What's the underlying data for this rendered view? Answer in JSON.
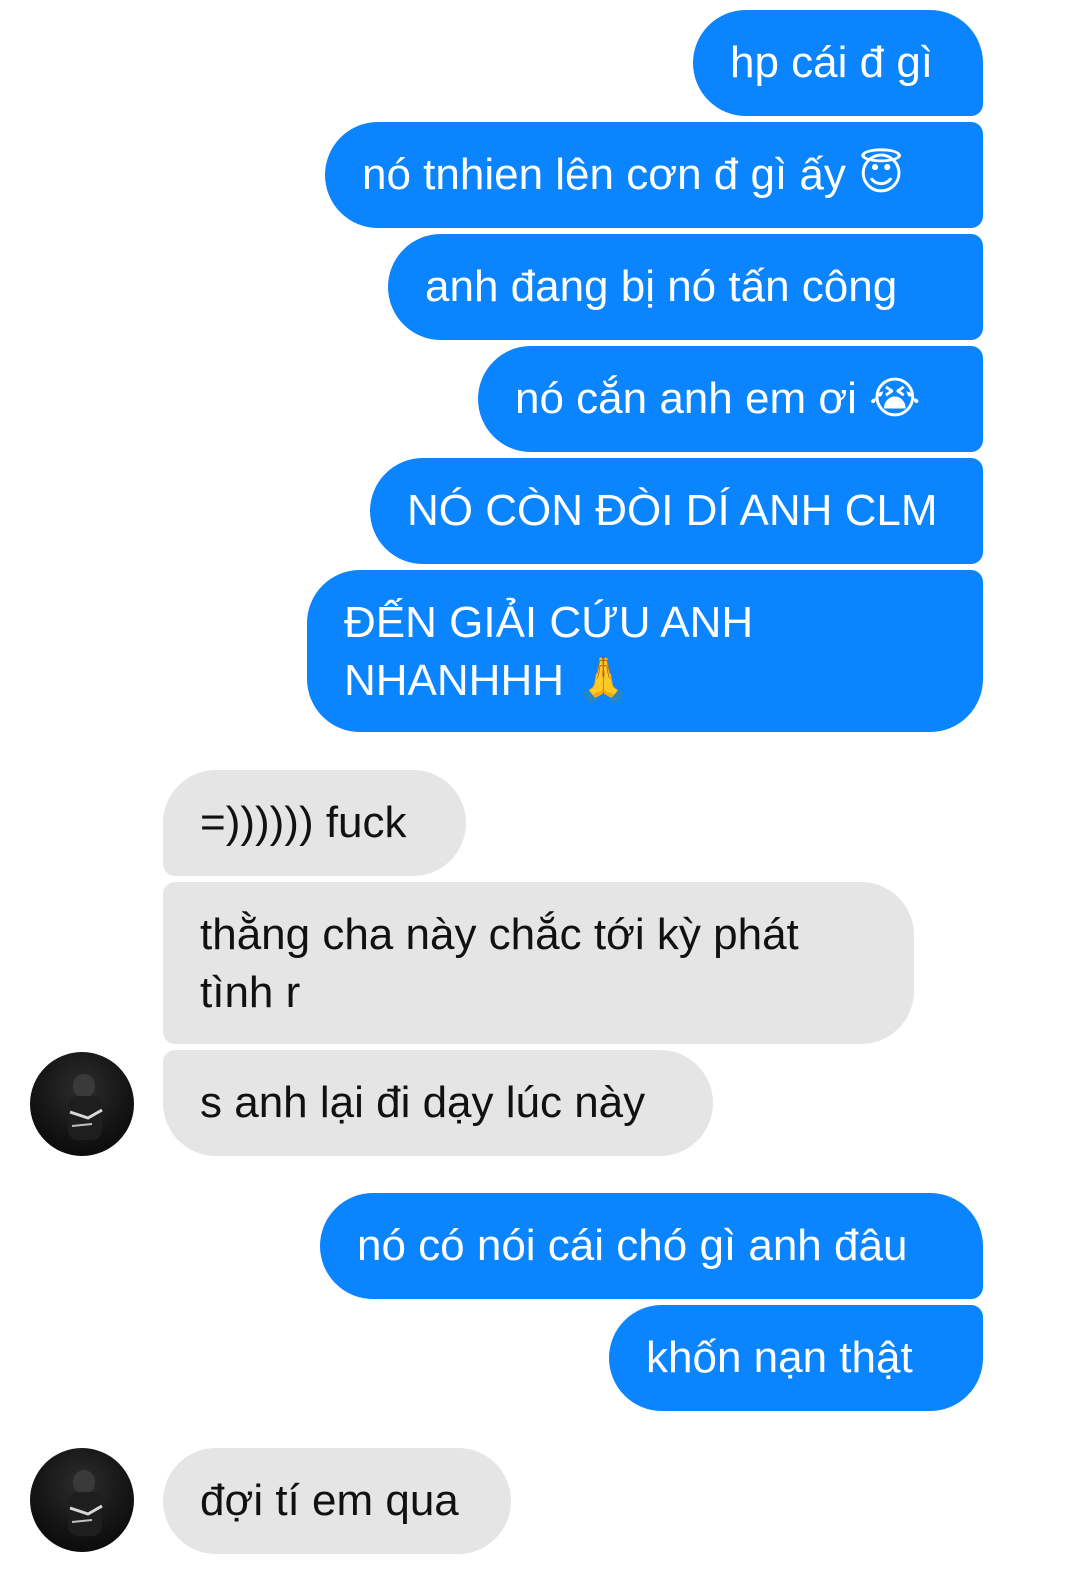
{
  "conversation": {
    "messages": [
      {
        "id": "m1",
        "side": "outgoing",
        "text": "hp cái đ gì"
      },
      {
        "id": "m2",
        "side": "outgoing",
        "text": "nó tnhien lên cơn đ gì ấy 😇"
      },
      {
        "id": "m3",
        "side": "outgoing",
        "text": "anh đang bị nó tấn công"
      },
      {
        "id": "m4",
        "side": "outgoing",
        "text": "nó cắn anh em ơi 😭"
      },
      {
        "id": "m5",
        "side": "outgoing",
        "text": "NÓ CÒN ĐÒI DÍ ANH CLM"
      },
      {
        "id": "m6",
        "side": "outgoing",
        "text": "ĐẾN GIẢI CỨU ANH\nNHANHHH 🙏"
      },
      {
        "id": "m7",
        "side": "incoming",
        "text": "=)))))) fuck"
      },
      {
        "id": "m8",
        "side": "incoming",
        "text": "thằng cha này chắc tới kỳ phát\ntình r"
      },
      {
        "id": "m9",
        "side": "incoming",
        "text": "s anh lại đi dạy lúc này"
      },
      {
        "id": "m10",
        "side": "outgoing",
        "text": "nó có nói cái chó gì anh đâu"
      },
      {
        "id": "m11",
        "side": "outgoing",
        "text": "khốn nạn thật"
      },
      {
        "id": "m12",
        "side": "incoming",
        "text": "đợi tí em qua"
      }
    ]
  },
  "colors": {
    "outgoing_bubble": "#0a84ff",
    "incoming_bubble": "#e5e5e5",
    "background": "#ffffff"
  },
  "icons": [
    "contact-avatar"
  ]
}
